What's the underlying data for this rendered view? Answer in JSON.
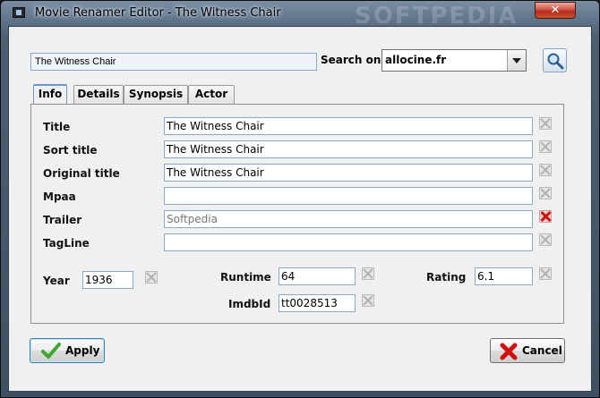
{
  "window": {
    "title": "Movie Renamer Editor - The Witness Chair",
    "close_label": "✕",
    "watermark": "SOFTPEDIA"
  },
  "header": {
    "movie_name": "The Witness Chair",
    "search_label": "Search on",
    "search_source": "allocine.fr"
  },
  "tabs": [
    {
      "label": "Info",
      "active": true
    },
    {
      "label": "Details",
      "active": false
    },
    {
      "label": "Synopsis",
      "active": false
    },
    {
      "label": "Actor",
      "active": false
    }
  ],
  "info": {
    "title_label": "Title",
    "title_value": "The Witness Chair",
    "sort_title_label": "Sort title",
    "sort_title_value": "The Witness Chair",
    "original_title_label": "Original title",
    "original_title_value": "The Witness Chair",
    "mpaa_label": "Mpaa",
    "mpaa_value": "",
    "trailer_label": "Trailer",
    "trailer_value": "Softpedia",
    "tagline_label": "TagLine",
    "tagline_value": "",
    "year_label": "Year",
    "year_value": "1936",
    "runtime_label": "Runtime",
    "runtime_value": "64",
    "rating_label": "Rating",
    "rating_value": "6.1",
    "imdbid_label": "ImdbId",
    "imdbid_value": "tt0028513"
  },
  "buttons": {
    "apply_label": "Apply",
    "cancel_label": "Cancel"
  },
  "colors": {
    "accent": "#6f95c9",
    "cancel_x": "#d40f0f",
    "apply_check": "#3aa829"
  }
}
